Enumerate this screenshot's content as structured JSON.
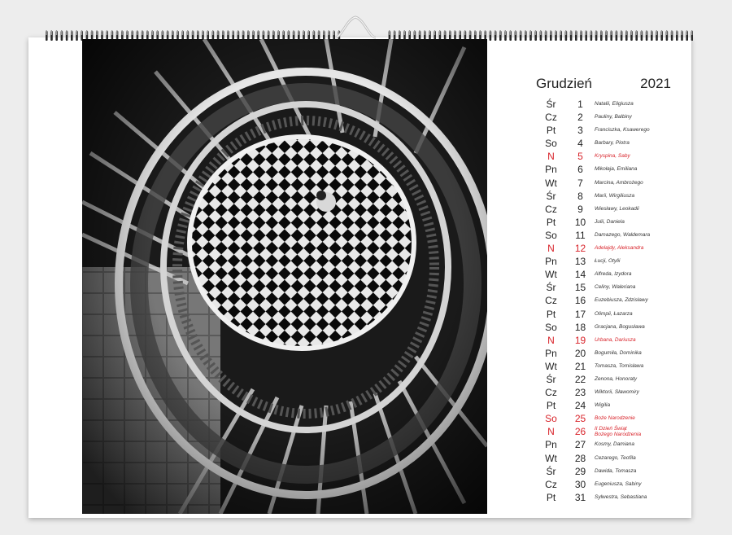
{
  "calendar": {
    "month": "Grudzień",
    "year": "2021",
    "holiday_color": "#d8232a",
    "days": [
      {
        "dow": "Śr",
        "num": "1",
        "names": "Natalii, Eligiusza",
        "holiday": false
      },
      {
        "dow": "Cz",
        "num": "2",
        "names": "Pauliny, Balbiny",
        "holiday": false
      },
      {
        "dow": "Pt",
        "num": "3",
        "names": "Franciszka, Ksawerego",
        "holiday": false
      },
      {
        "dow": "So",
        "num": "4",
        "names": "Barbary, Piotra",
        "holiday": false
      },
      {
        "dow": "N",
        "num": "5",
        "names": "Kryspina, Saby",
        "holiday": true
      },
      {
        "dow": "Pn",
        "num": "6",
        "names": "Mikołaja, Emiliana",
        "holiday": false
      },
      {
        "dow": "Wt",
        "num": "7",
        "names": "Marcina, Ambrożego",
        "holiday": false
      },
      {
        "dow": "Śr",
        "num": "8",
        "names": "Marii, Wirgiliusza",
        "holiday": false
      },
      {
        "dow": "Cz",
        "num": "9",
        "names": "Wiesławy, Leokadii",
        "holiday": false
      },
      {
        "dow": "Pt",
        "num": "10",
        "names": "Julii, Daniela",
        "holiday": false
      },
      {
        "dow": "So",
        "num": "11",
        "names": "Damazego, Waldemara",
        "holiday": false
      },
      {
        "dow": "N",
        "num": "12",
        "names": "Adelajdy, Aleksandra",
        "holiday": true
      },
      {
        "dow": "Pn",
        "num": "13",
        "names": "Łucji, Otylii",
        "holiday": false
      },
      {
        "dow": "Wt",
        "num": "14",
        "names": "Alfreda, Izydora",
        "holiday": false
      },
      {
        "dow": "Śr",
        "num": "15",
        "names": "Celiny, Waleriana",
        "holiday": false
      },
      {
        "dow": "Cz",
        "num": "16",
        "names": "Euzebiusza, Zdzisławy",
        "holiday": false
      },
      {
        "dow": "Pt",
        "num": "17",
        "names": "Olimpii, Łazarza",
        "holiday": false
      },
      {
        "dow": "So",
        "num": "18",
        "names": "Gracjana, Bogusława",
        "holiday": false
      },
      {
        "dow": "N",
        "num": "19",
        "names": "Urbana, Dariusza",
        "holiday": true
      },
      {
        "dow": "Pn",
        "num": "20",
        "names": "Bogumiła, Dominika",
        "holiday": false
      },
      {
        "dow": "Wt",
        "num": "21",
        "names": "Tomasza, Tomisława",
        "holiday": false
      },
      {
        "dow": "Śr",
        "num": "22",
        "names": "Zenona, Honoraty",
        "holiday": false
      },
      {
        "dow": "Cz",
        "num": "23",
        "names": "Wiktorii, Sławomiry",
        "holiday": false
      },
      {
        "dow": "Pt",
        "num": "24",
        "names": "Wigilia",
        "holiday": false
      },
      {
        "dow": "So",
        "num": "25",
        "names": "Boże Narodzenie",
        "holiday": true
      },
      {
        "dow": "N",
        "num": "26",
        "names": "II Dzień Świąt",
        "names2": "Bożego Narodzenia",
        "holiday": true
      },
      {
        "dow": "Pn",
        "num": "27",
        "names": "Kosmy, Damiana",
        "holiday": false
      },
      {
        "dow": "Wt",
        "num": "28",
        "names": "Cezarego, Teofila",
        "holiday": false
      },
      {
        "dow": "Śr",
        "num": "29",
        "names": "Dawida, Tomasza",
        "holiday": false
      },
      {
        "dow": "Cz",
        "num": "30",
        "names": "Eugeniusza, Sabiny",
        "holiday": false
      },
      {
        "dow": "Pt",
        "num": "31",
        "names": "Sylwestra, Sebastiana",
        "holiday": false
      }
    ]
  }
}
